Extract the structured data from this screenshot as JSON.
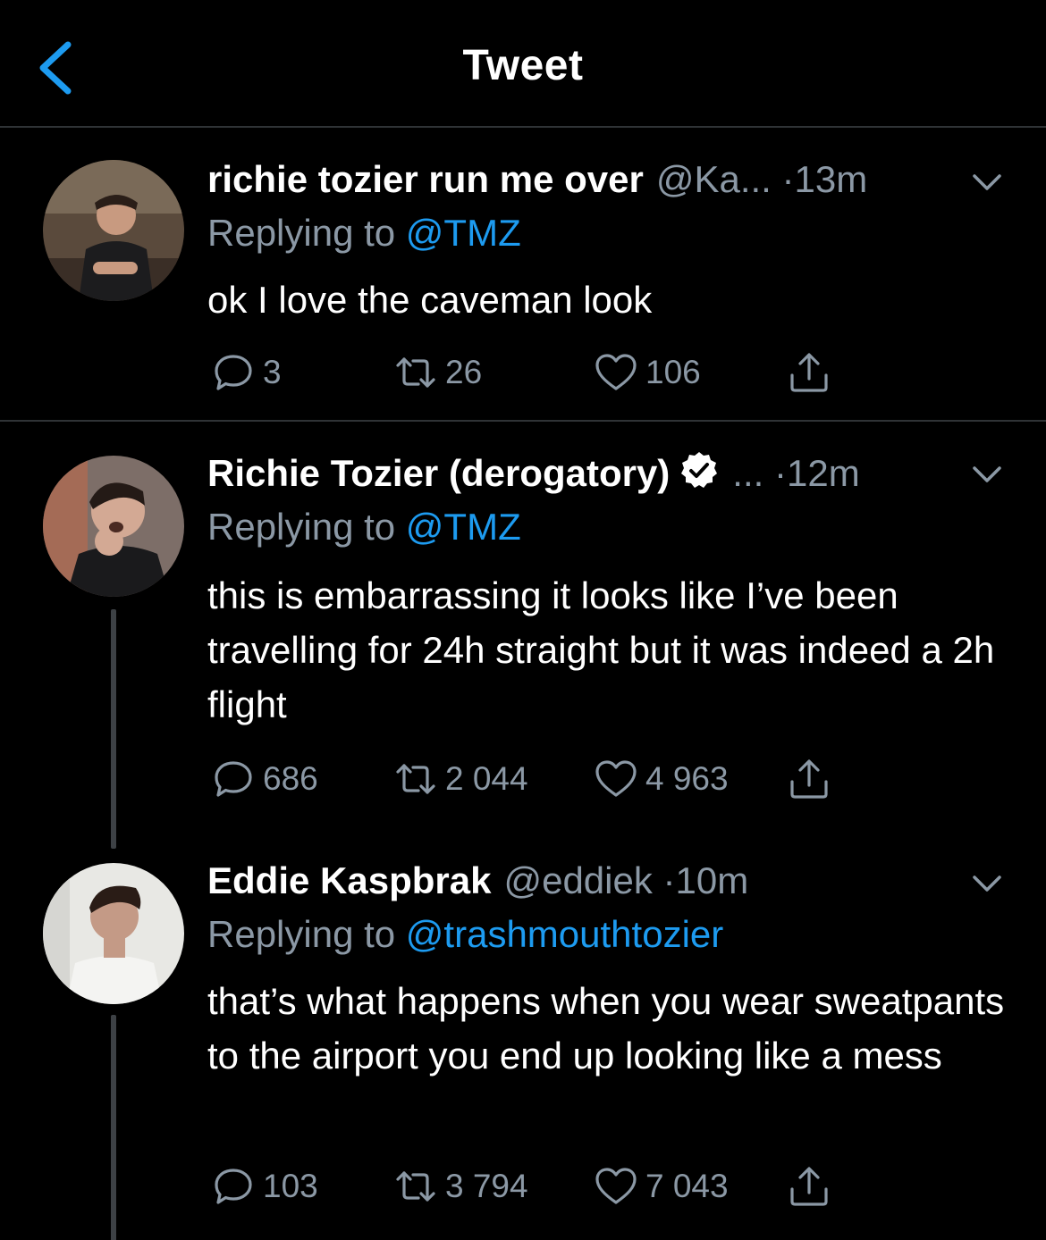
{
  "header": {
    "title": "Tweet",
    "back_icon": "chevron-left-icon"
  },
  "colors": {
    "background": "#000000",
    "accent": "#1d9bf0",
    "muted": "#8b98a5",
    "divider": "#2f3336"
  },
  "tweets": [
    {
      "name": "richie tozier run me over",
      "handle": "@Ka...",
      "dot": "·",
      "time": "13m",
      "verified": false,
      "replying_prefix": "Replying to",
      "replying_to": "@TMZ",
      "body": "ok I love the caveman look",
      "replies": "3",
      "retweets": "26",
      "likes": "106"
    },
    {
      "name": "Richie Tozier (derogatory)",
      "handle": "...",
      "dot": "·",
      "time": "12m",
      "verified": true,
      "replying_prefix": "Replying to",
      "replying_to": "@TMZ",
      "body": "this is embarrassing it looks like I’ve been travelling for 24h straight but it was indeed a 2h flight",
      "replies": "686",
      "retweets": "2 044",
      "likes": "4 963"
    },
    {
      "name": "Eddie Kaspbrak",
      "handle": "@eddiek",
      "dot": "·",
      "time": "10m",
      "verified": false,
      "replying_prefix": "Replying to",
      "replying_to": "@trashmouthtozier",
      "body": "that’s what happens when you wear sweatpants to the airport you end up looking like a mess",
      "replies": "103",
      "retweets": "3 794",
      "likes": "7 043"
    }
  ]
}
